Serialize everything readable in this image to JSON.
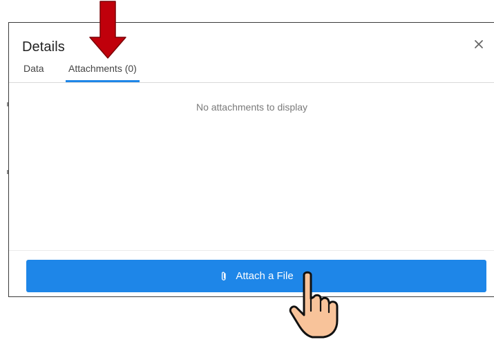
{
  "panel": {
    "title": "Details",
    "close_glyph": "×"
  },
  "tabs": [
    {
      "label": "Data",
      "active": false
    },
    {
      "label": "Attachments (0)",
      "active": true
    }
  ],
  "attachments": {
    "empty_message": "No attachments to display"
  },
  "footer": {
    "attach_button_label": "Attach a File",
    "attach_button_icon": "paperclip-icon"
  },
  "annotations": {
    "arrow": "down-arrow-icon",
    "cursor": "hand-pointer-icon"
  },
  "colors": {
    "accent": "#1e86e8",
    "arrow_fill": "#c0000b",
    "hand_fill": "#f8c39a"
  }
}
